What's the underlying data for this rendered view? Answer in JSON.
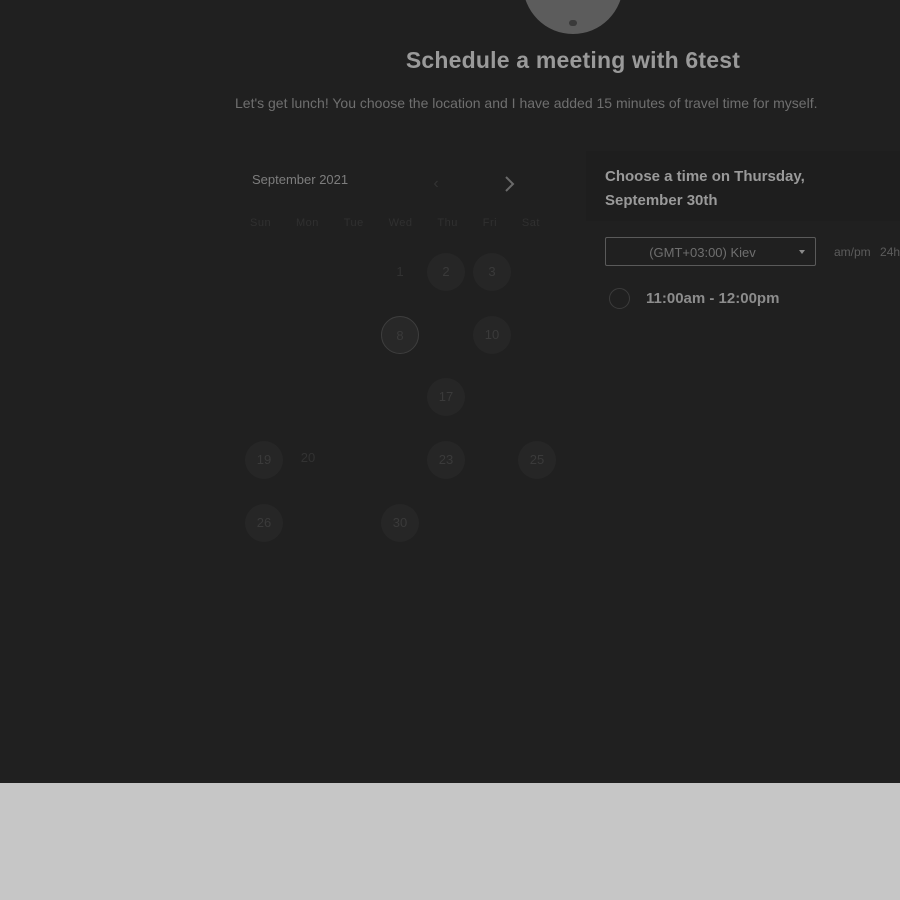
{
  "header": {
    "title": "Schedule a meeting with 6test",
    "subtitle": "Let's get lunch! You choose the location and I have added 15 minutes of travel time for myself."
  },
  "calendar": {
    "month_label": "September 2021",
    "prev_icon": "chevron-left-icon",
    "next_icon": "chevron-right-icon",
    "weekdays": [
      "Sun",
      "Mon",
      "Tue",
      "Wed",
      "Thu",
      "Fri",
      "Sat"
    ],
    "days": [
      {
        "label": "1",
        "state": "plain"
      },
      {
        "label": "2",
        "state": "available"
      },
      {
        "label": "3",
        "state": "available"
      },
      {
        "label": "8",
        "state": "selected"
      },
      {
        "label": "10",
        "state": "available"
      },
      {
        "label": "17",
        "state": "available"
      },
      {
        "label": "19",
        "state": "available"
      },
      {
        "label": "20",
        "state": "plain"
      },
      {
        "label": "23",
        "state": "available"
      },
      {
        "label": "25",
        "state": "available"
      },
      {
        "label": "26",
        "state": "available"
      },
      {
        "label": "30",
        "state": "available"
      }
    ]
  },
  "time_picker": {
    "heading": "Choose a time on Thursday, September 30th",
    "timezone": "(GMT+03:00) Kiev",
    "timezone_icon": "caret-down-icon",
    "format_options": [
      "am/pm",
      "24h"
    ],
    "slots": [
      "11:00am - 12:00pm"
    ]
  },
  "colors": {
    "overlay_background": "#202020",
    "footer_background": "#c6c6c6"
  }
}
